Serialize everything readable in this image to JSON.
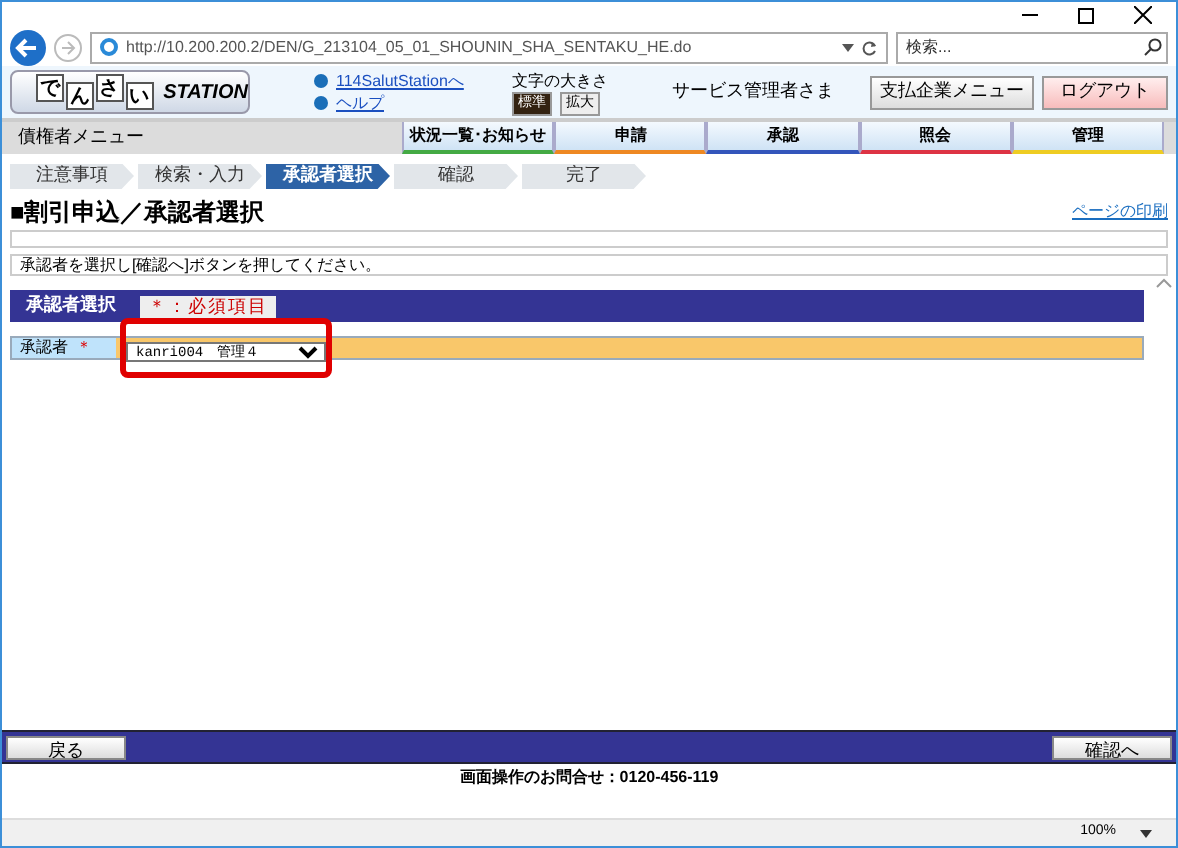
{
  "browser": {
    "url": "http://10.200.200.2/DEN/G_213104_05_01_SHOUNIN_SHA_SENTAKU_HE.do",
    "search": {
      "placeholder": "検索..."
    },
    "zoom": "100%"
  },
  "header": {
    "logo_chars": [
      "で",
      "ん",
      "さ",
      "い"
    ],
    "logo_word": "STATION",
    "links": [
      "114SalutStationへ",
      "ヘルプ"
    ],
    "font_size_label": "文字の大きさ",
    "font_sizes": [
      {
        "label": "標準",
        "selected": true
      },
      {
        "label": "拡大",
        "selected": false
      }
    ],
    "user": "サービス管理者さま",
    "menu_button": "支払企業メニュー",
    "logout_button": "ログアウト"
  },
  "nav": {
    "menu_label": "債権者メニュー",
    "tabs": [
      {
        "label": "状況一覧･お知らせ",
        "color": "#44aa44"
      },
      {
        "label": "申請",
        "color": "#ee8822"
      },
      {
        "label": "承認",
        "color": "#3355bb"
      },
      {
        "label": "照会",
        "color": "#dd3344"
      },
      {
        "label": "管理",
        "color": "#eecc22"
      }
    ]
  },
  "steps": [
    {
      "label": "注意事項",
      "selected": false
    },
    {
      "label": "検索・入力",
      "selected": false
    },
    {
      "label": "承認者選択",
      "selected": true
    },
    {
      "label": "確認",
      "selected": false
    },
    {
      "label": "完了",
      "selected": false
    }
  ],
  "page": {
    "title": "■割引申込／承認者選択",
    "print_link": "ページの印刷",
    "instruction": "承認者を選択し[確認へ]ボタンを押してください。"
  },
  "section": {
    "title": "承認者選択",
    "required_badge": "＊：必須項目",
    "field_label": "承認者",
    "required_mark": "＊",
    "select_value": "kanri004　管理４"
  },
  "footer": {
    "back_button": "戻る",
    "next_button": "確認へ",
    "contact": "画面操作のお問合せ：0120-456-119"
  }
}
